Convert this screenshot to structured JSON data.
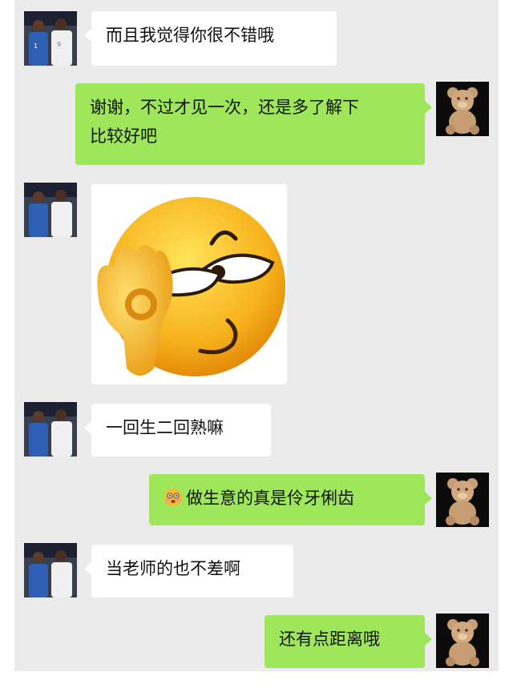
{
  "messages": [
    {
      "side": "left",
      "type": "text",
      "text": "而且我觉得你很不错哦"
    },
    {
      "side": "right",
      "type": "text",
      "lines": [
        "谢谢，不过才见一次，还是多了解下",
        "比较好吧"
      ]
    },
    {
      "side": "left",
      "type": "sticker",
      "sticker": "smirk-ok-hand-emoji"
    },
    {
      "side": "left",
      "type": "text",
      "text": "一回生二回熟嘛"
    },
    {
      "side": "right",
      "type": "text",
      "emoji": "awkward-face-emoji",
      "text": "做生意的真是伶牙俐齿"
    },
    {
      "side": "left",
      "type": "text",
      "text": "当老师的也不差啊"
    },
    {
      "side": "right",
      "type": "text",
      "text": "还有点距离哦"
    }
  ],
  "avatars": {
    "left": "basketball-players-avatar",
    "right": "teddy-bear-avatar"
  },
  "colors": {
    "background": "#ebebeb",
    "sent_bubble": "#9ee65a",
    "received_bubble": "#ffffff"
  }
}
